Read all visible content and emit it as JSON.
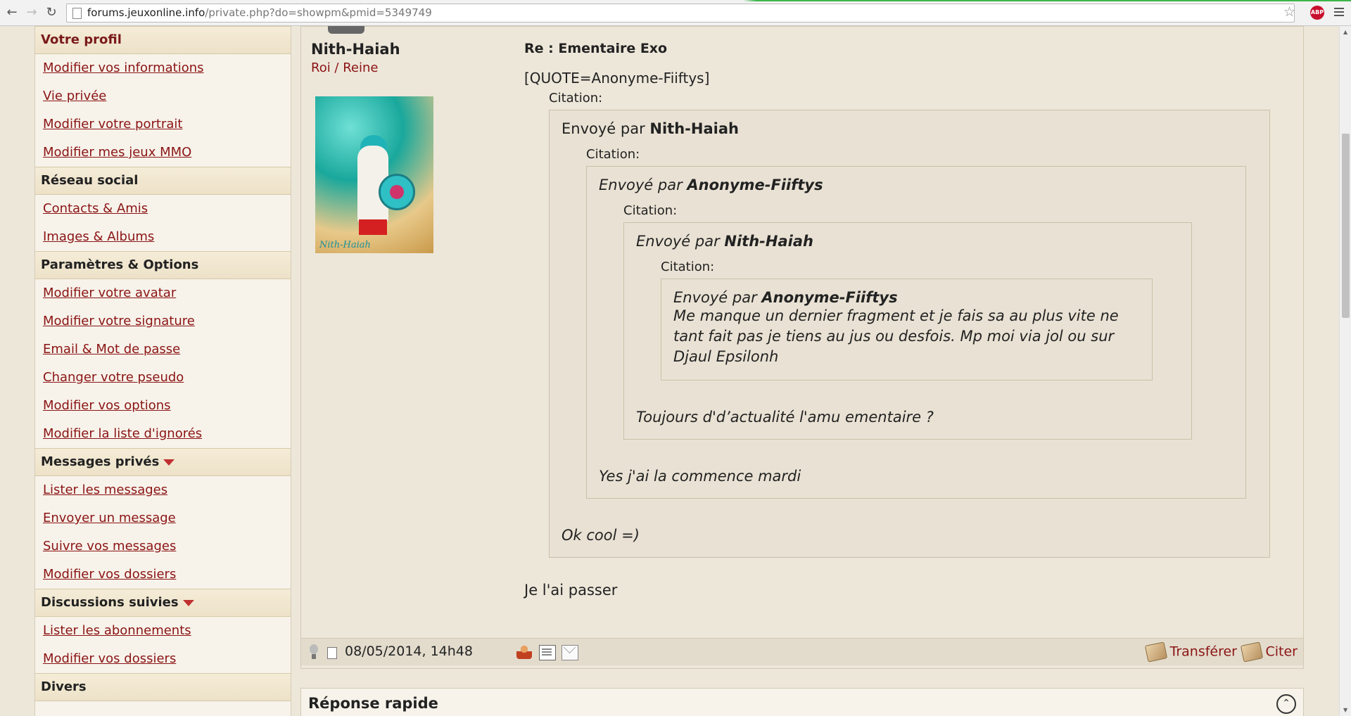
{
  "browser": {
    "url_host": "forums.jeuxonline.info",
    "url_path": "/private.php?do=showpm&pmid=5349749",
    "abp_label": "ABP"
  },
  "sidebar": {
    "sections": [
      {
        "title": "Votre profil",
        "dropdown": false,
        "items": [
          "Modifier vos informations",
          "Vie privée",
          "Modifier votre portrait",
          "Modifier mes jeux MMO"
        ]
      },
      {
        "title": "Réseau social",
        "dropdown": false,
        "items": [
          "Contacts & Amis",
          "Images & Albums"
        ]
      },
      {
        "title": "Paramètres & Options",
        "dropdown": false,
        "items": [
          "Modifier votre avatar",
          "Modifier votre signature",
          "Email & Mot de passe",
          "Changer votre pseudo",
          "Modifier vos options",
          "Modifier la liste d'ignorés"
        ]
      },
      {
        "title": "Messages privés",
        "dropdown": true,
        "items": [
          "Lister les messages",
          "Envoyer un message",
          "Suivre vos messages",
          "Modifier vos dossiers"
        ]
      },
      {
        "title": "Discussions suivies",
        "dropdown": true,
        "items": [
          "Lister les abonnements",
          "Modifier vos dossiers"
        ]
      },
      {
        "title": "Divers",
        "dropdown": false,
        "items": []
      }
    ]
  },
  "post": {
    "author": "Nith-Haiah",
    "rank": "Roi / Reine",
    "avatar_signature": "Nith-Haiah",
    "title": "Re : Ementaire Exo",
    "quote_tag": "[QUOTE=Anonyme-Fiiftys]",
    "citation_label": "Citation:",
    "sent_by_label": "Envoyé par",
    "quotes": {
      "q1_author": "Nith-Haiah",
      "q2_author": "Anonyme-Fiiftys",
      "q3_author": "Nith-Haiah",
      "q4_author": "Anonyme-Fiiftys",
      "q4_text": "Me manque un dernier fragment et je fais sa au plus vite ne tant fait pas je tiens au jus ou desfois. Mp moi via jol ou sur Djaul Epsilonh",
      "q3_text": "Toujours d'd’actualité l'amu ementaire ?",
      "q2_text": "Yes j'ai la commence mardi",
      "q1_text": "Ok cool =)"
    },
    "reply": "Je l'ai passer",
    "date": "08/05/2014, 14h48",
    "forward_label": "Transférer",
    "quote_label": "Citer"
  },
  "quick_reply": {
    "title": "Réponse rapide"
  }
}
